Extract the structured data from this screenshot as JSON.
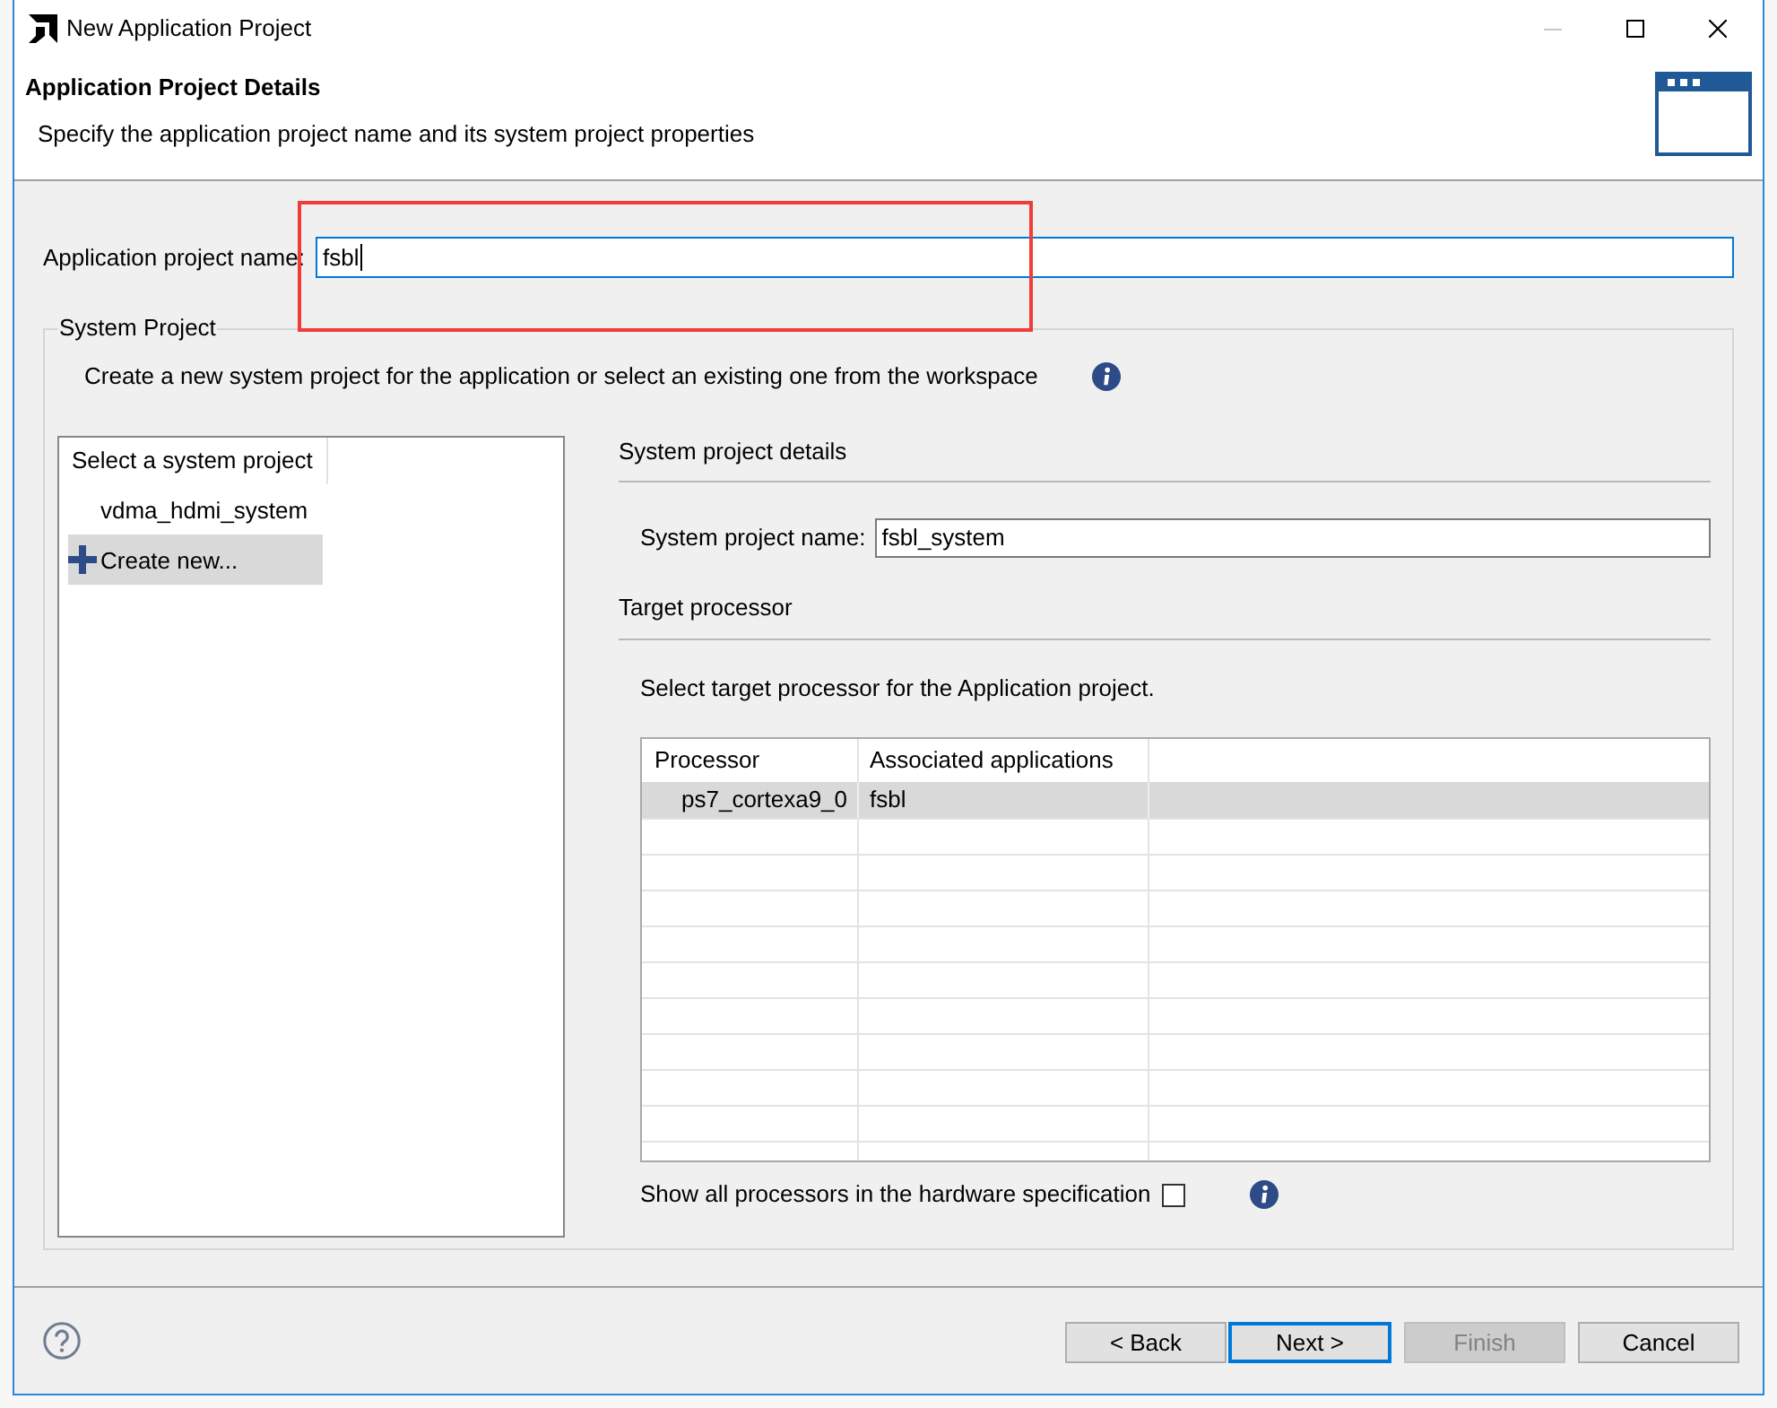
{
  "window": {
    "title": "New Application Project",
    "controls": [
      {
        "kind": "minimize",
        "disabled": true
      },
      {
        "kind": "maximize",
        "disabled": false
      },
      {
        "kind": "close",
        "disabled": false
      }
    ]
  },
  "header": {
    "title": "Application Project Details",
    "subtitle": "Specify the application project name and its system project properties"
  },
  "project_name": {
    "label": "Application project name:",
    "value": "fsbl",
    "focused": true
  },
  "annotations": [
    {
      "kind": "rectangle"
    }
  ],
  "system_project": {
    "legend": "System Project",
    "description": "Create a new system project for the application or select an existing one from the workspace",
    "list": {
      "header": "Select a system project",
      "items": [
        {
          "label": "vdma_hdmi_system",
          "kind": "project",
          "selected": false
        },
        {
          "label": "Create new...",
          "kind": "create",
          "selected": true
        }
      ]
    },
    "details": {
      "heading": "System project details",
      "name_field": {
        "label": "System project name:",
        "value": "fsbl_system",
        "focused": false
      }
    },
    "target": {
      "heading": "Target processor",
      "instruction": "Select target processor for the Application project.",
      "table": {
        "columns": [
          "Processor",
          "Associated applications"
        ],
        "rows": [
          {
            "cells": [
              "ps7_cortexa9_0",
              "fsbl"
            ],
            "selected": true
          }
        ]
      },
      "show_all": {
        "label": "Show all processors in the hardware specification",
        "checked": false
      }
    }
  },
  "buttons": [
    {
      "label": "< Back",
      "default": false,
      "disabled": false
    },
    {
      "label": "Next >",
      "default": true,
      "disabled": false
    },
    {
      "label": "Finish",
      "default": false,
      "disabled": true
    },
    {
      "label": "Cancel",
      "default": false,
      "disabled": false
    }
  ]
}
